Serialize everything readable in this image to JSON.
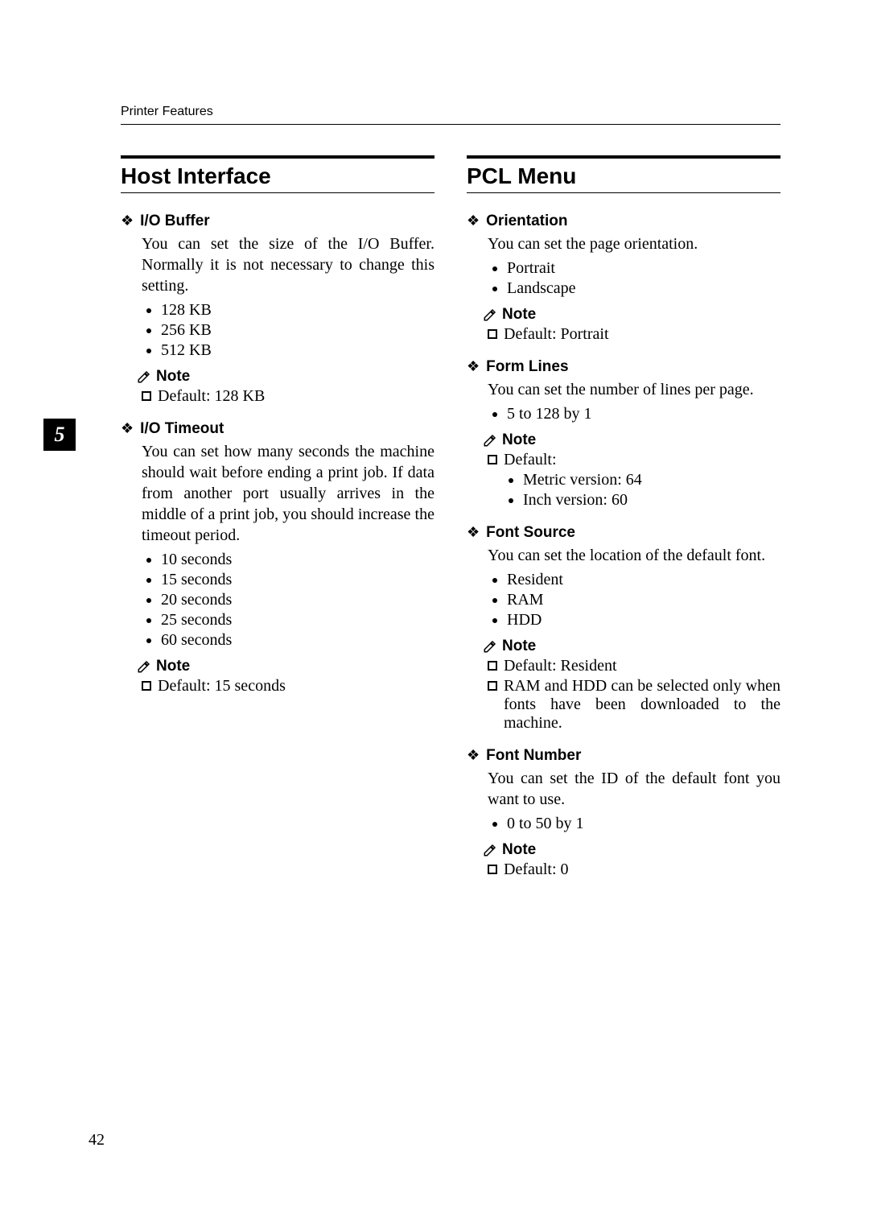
{
  "header": "Printer Features",
  "page_number": "42",
  "chapter_tab": "5",
  "note_label": "Note",
  "left": {
    "title": "Host Interface",
    "settings": [
      {
        "title": "I/O Buffer",
        "desc": "You can set the size of the I/O Buffer. Normally it is not necessary to change this setting.",
        "options": [
          "128 KB",
          "256 KB",
          "512 KB"
        ],
        "notes": [
          {
            "text": "Default: 128 KB"
          }
        ]
      },
      {
        "title": "I/O Timeout",
        "desc": "You can set how many seconds the machine should wait before ending a print job. If data from another port usually arrives in the middle of a print job, you should increase the timeout period.",
        "options": [
          "10 seconds",
          "15 seconds",
          "20 seconds",
          "25 seconds",
          "60 seconds"
        ],
        "notes": [
          {
            "text": "Default: 15 seconds"
          }
        ]
      }
    ]
  },
  "right": {
    "title": "PCL Menu",
    "settings": [
      {
        "title": "Orientation",
        "desc": "You can set the page orientation.",
        "options": [
          "Portrait",
          "Landscape"
        ],
        "notes": [
          {
            "text": "Default: Portrait"
          }
        ]
      },
      {
        "title": "Form Lines",
        "desc": "You can set the number of lines per page.",
        "options": [
          "5 to 128 by 1"
        ],
        "notes": [
          {
            "text": "Default:",
            "sub": [
              "Metric version: 64",
              "Inch version: 60"
            ]
          }
        ]
      },
      {
        "title": "Font Source",
        "desc": "You can set the location of the default font.",
        "options": [
          "Resident",
          "RAM",
          "HDD"
        ],
        "notes": [
          {
            "text": "Default: Resident"
          },
          {
            "text": "RAM and HDD can be selected only when fonts have been downloaded to the machine."
          }
        ]
      },
      {
        "title": "Font Number",
        "desc": "You can set the ID of the default font you want to use.",
        "options": [
          "0 to 50 by 1"
        ],
        "notes": [
          {
            "text": "Default: 0"
          }
        ]
      }
    ]
  }
}
